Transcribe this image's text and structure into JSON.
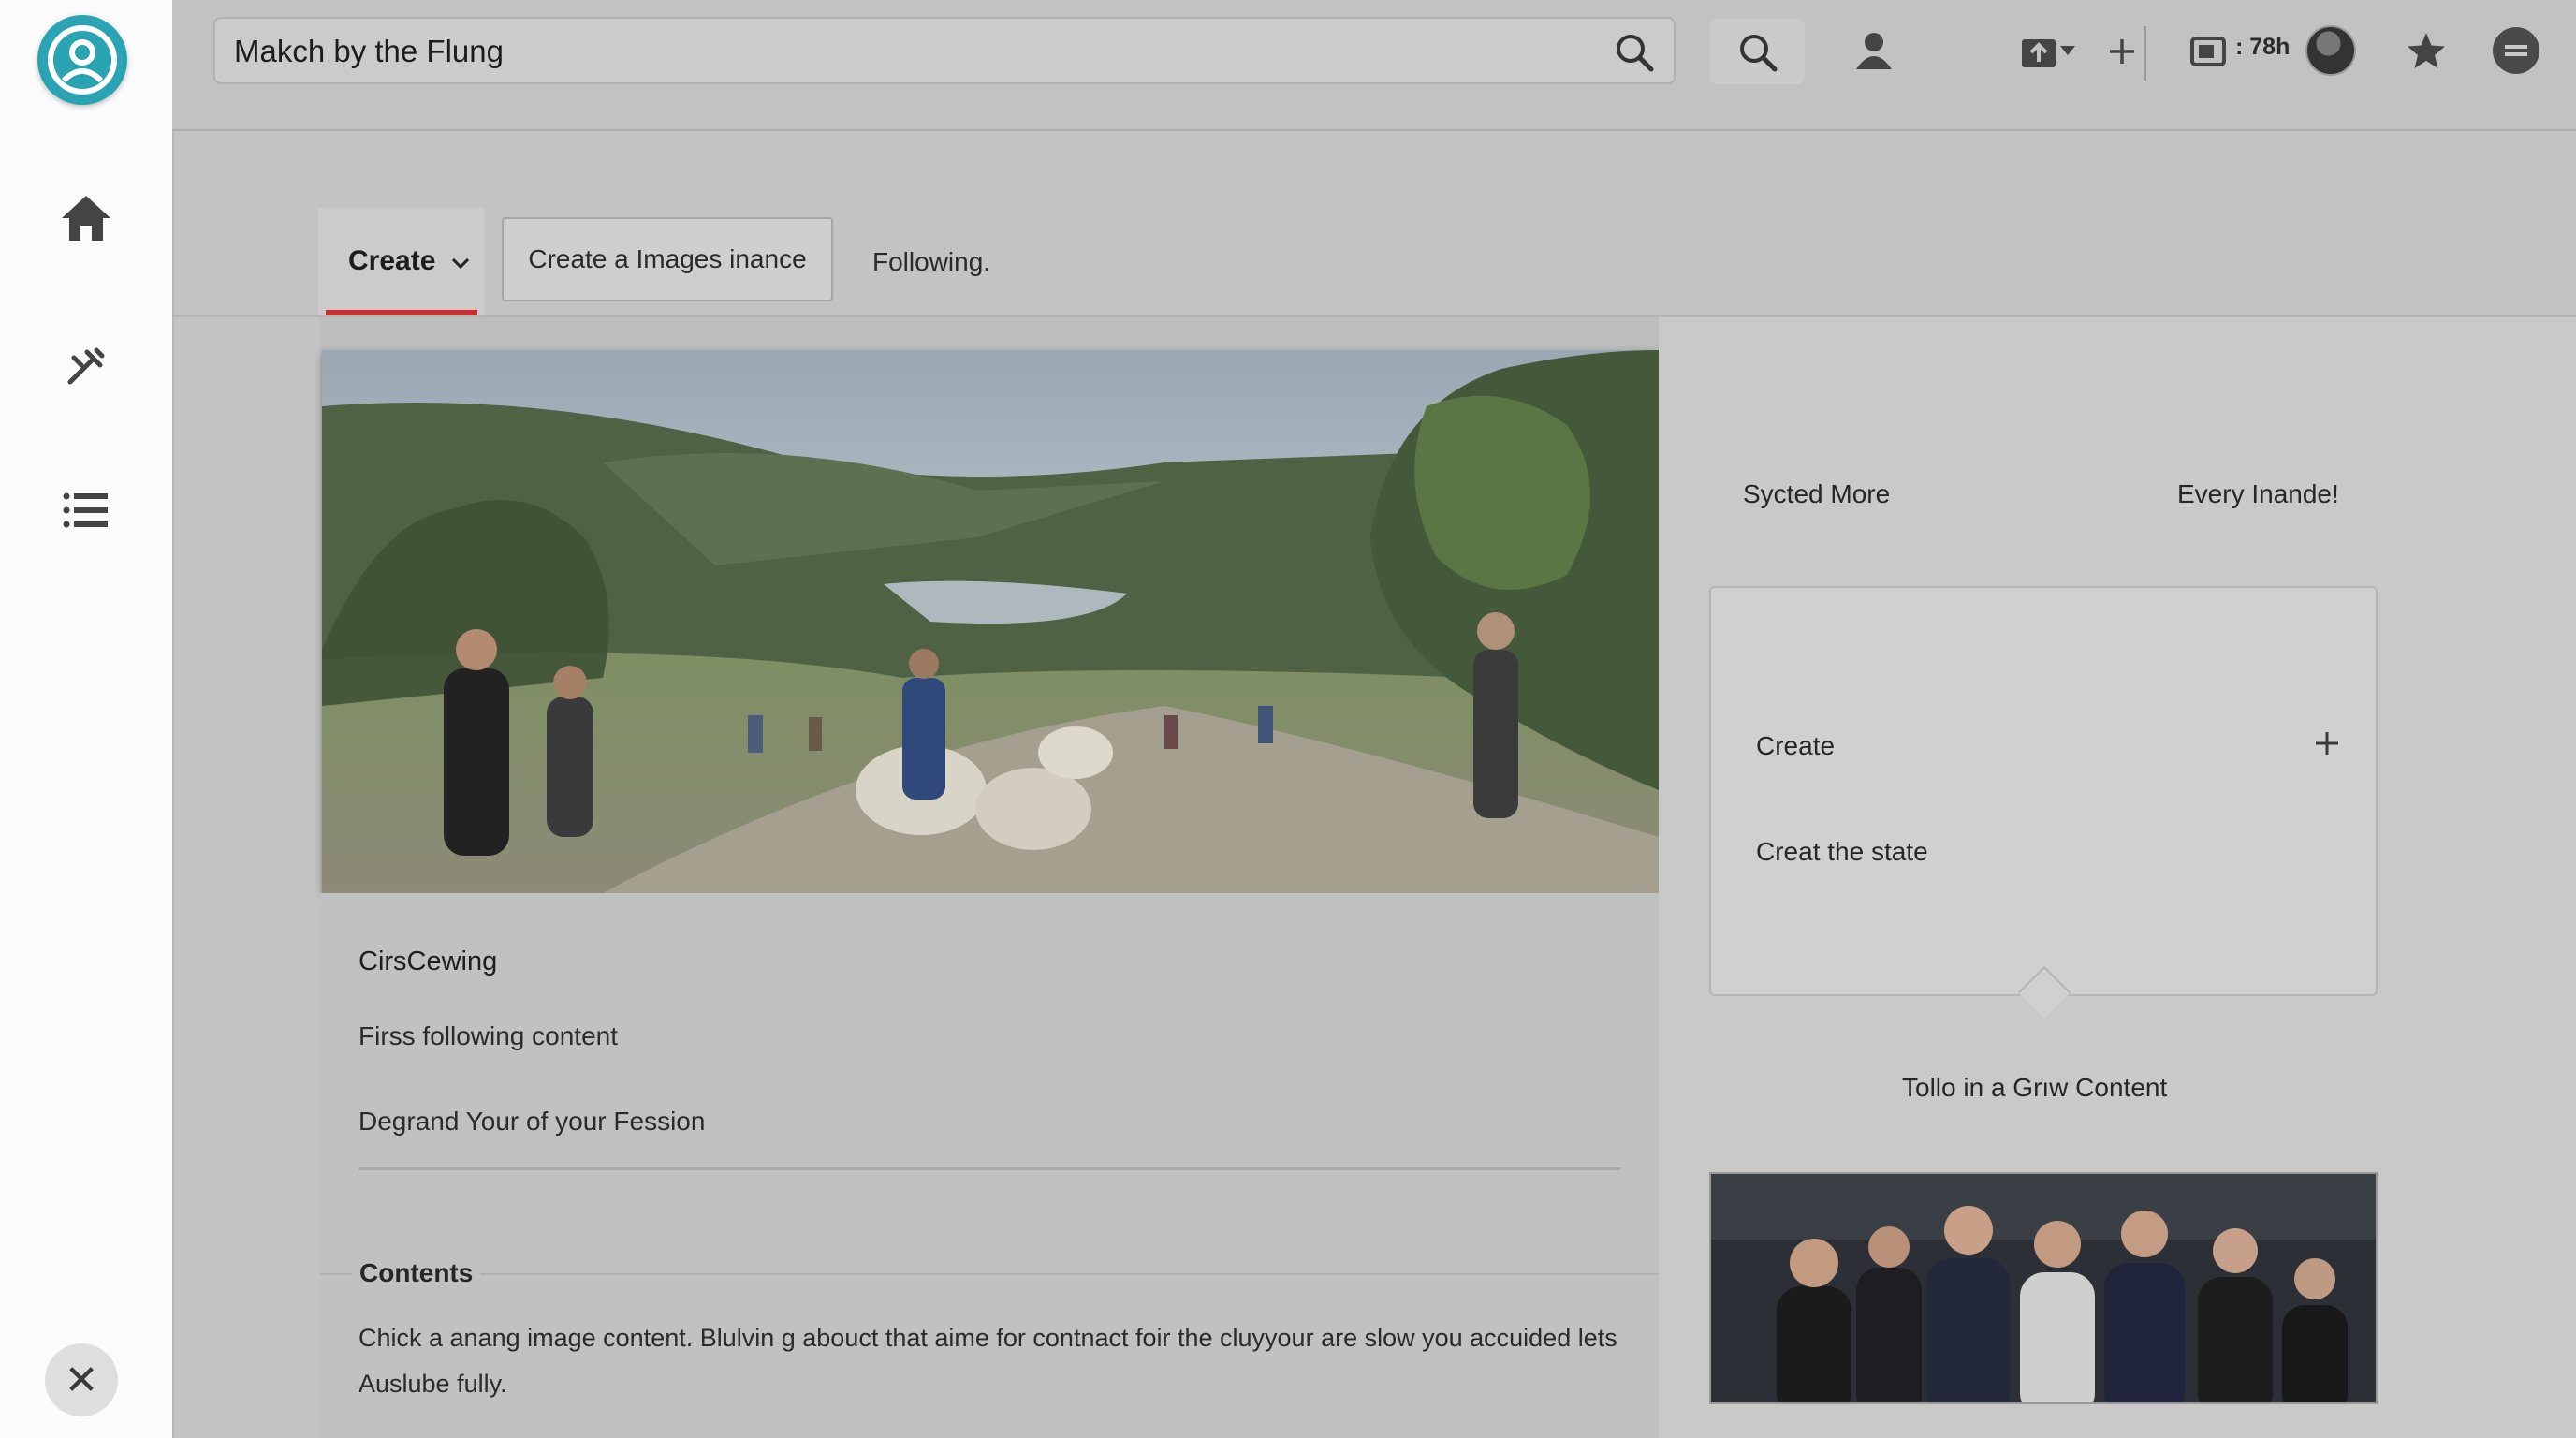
{
  "search": {
    "value": "Makch by the Flung"
  },
  "toolbar": {
    "counter": ": 78h"
  },
  "tabs": {
    "create_label": "Create",
    "create_images_label": "Create a Images inance",
    "following_label": "Following."
  },
  "post": {
    "title": "CirsCewing",
    "subtitle": "Firss following content",
    "description": "Degrand Your of your Fession",
    "contents_heading": "Contents",
    "contents_body_line1": "Chick a anang image content. Blulvin g abouct that aime for contnact foir the cluyyour are slow you accuided lets",
    "contents_body_line2": "Auslube fully."
  },
  "right": {
    "synced_more": "Sycted More",
    "every_inande": "Every Inande!",
    "panel_create": "Create",
    "panel_create_state": "Creat the state",
    "follow_grow": "Tollo in a Grıw Content"
  },
  "colors": {
    "accent": "#d42a2a",
    "brand": "#2aa3b3"
  },
  "icons": [
    "profile-logo-icon",
    "home-icon",
    "tools-icon",
    "list-icon",
    "close-icon",
    "search-icon",
    "user-icon",
    "upload-icon",
    "plus-icon",
    "video-icon",
    "star-icon",
    "menu-icon",
    "chevron-down-icon"
  ]
}
